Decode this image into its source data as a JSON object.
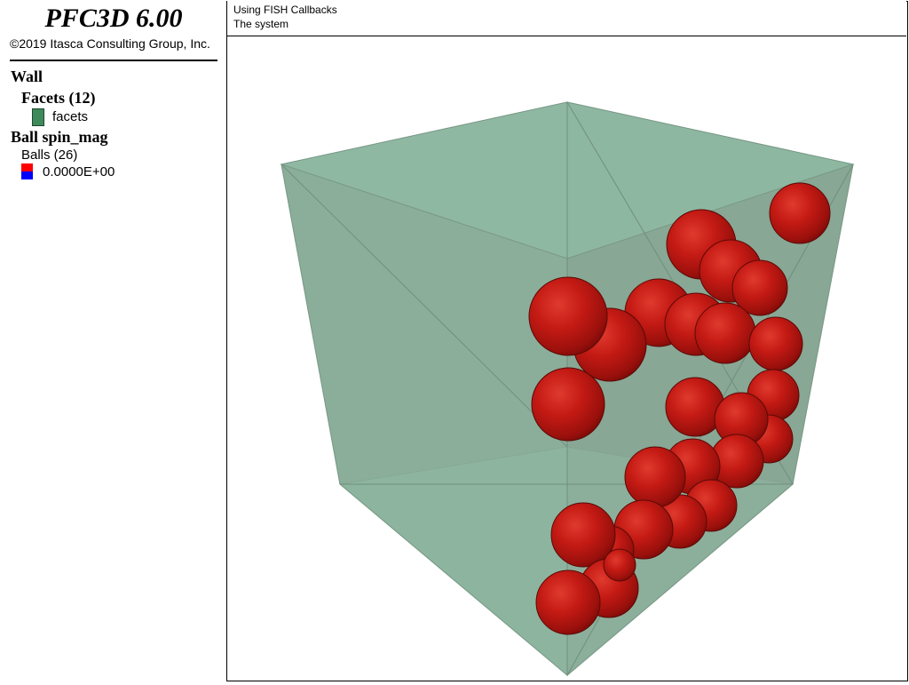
{
  "app": {
    "title": "PFC3D 6.00",
    "copyright": "©2019 Itasca Consulting Group, Inc."
  },
  "header": {
    "line1": "Using FISH Callbacks",
    "line2": "The system"
  },
  "legend": {
    "wall_heading": "Wall",
    "facets_heading": "Facets (12)",
    "facets_label": "facets",
    "facets_color": "#3e8a5a",
    "ball_heading": "Ball spin_mag",
    "balls_label": "Balls (26)",
    "spin_value": "0.0000E+00",
    "spin_colors": [
      "#ff0000",
      "#0000ff"
    ]
  },
  "scene": {
    "wall_fill": "#8fb8a2",
    "ball_color": "#c41a14",
    "ball_count": 26
  }
}
